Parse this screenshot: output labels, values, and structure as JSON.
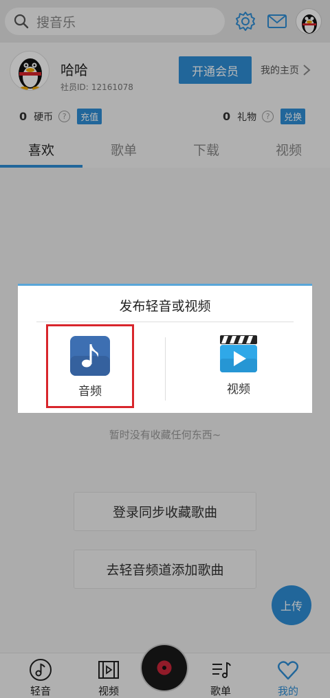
{
  "search": {
    "placeholder": "搜音乐"
  },
  "profile": {
    "name": "哈哈",
    "id_label": "社员ID:",
    "id_value": "12161078",
    "vip_button": "开通会员",
    "home_link": "我的主页"
  },
  "stats": {
    "coins": {
      "value": "0",
      "label": "硬币",
      "action": "充值"
    },
    "gifts": {
      "value": "0",
      "label": "礼物",
      "action": "兑换"
    }
  },
  "tabs": [
    "喜欢",
    "歌单",
    "下载",
    "视频"
  ],
  "active_tab": "喜欢",
  "content": {
    "empty_text": "暂时没有收藏任何东西~",
    "login_sync_button": "登录同步收藏歌曲",
    "add_songs_button": "去轻音频道添加歌曲",
    "upload_button": "上传"
  },
  "dialog": {
    "title": "发布轻音或视频",
    "audio_label": "音频",
    "video_label": "视频"
  },
  "bottom_nav": [
    "轻音",
    "视频",
    "歌单",
    "我的"
  ],
  "colors": {
    "accent": "#2e8ed6",
    "highlight": "#d8252b",
    "audio_icon_bg": "#3d6fb2",
    "video_icon_bg": "#2fa8e8"
  },
  "icons": [
    "search-icon",
    "gear-icon",
    "mail-icon",
    "avatar",
    "chevron-right-icon",
    "question-icon",
    "music-note-icon",
    "video-play-icon",
    "playlist-icon",
    "heart-icon",
    "disc-icon"
  ]
}
